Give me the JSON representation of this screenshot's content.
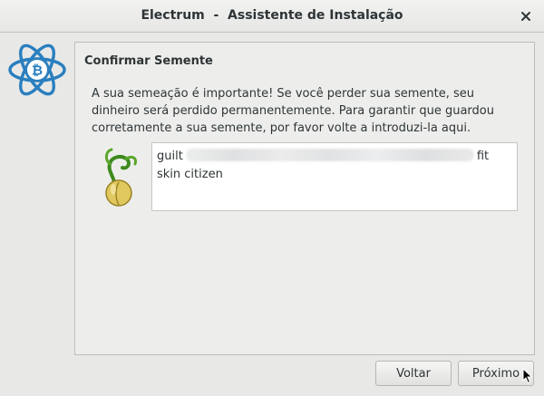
{
  "window": {
    "title": "Electrum  -  Assistente de Instalação",
    "close_icon": "close-icon"
  },
  "logo": {
    "icon": "electrum-bitcoin-atom-logo",
    "color": "#2a7fbf"
  },
  "page": {
    "section_title": "Confirmar Semente",
    "message": "A sua semeação é importante! Se você perder sua semente, seu dinheiro será perdido permanentemente. Para garantir que guardou corretamente a sua semente, por favor volte a introduzi-la aqui.",
    "seed_icon": "seed-sprout-icon",
    "seed_input": {
      "first_word": "guilt",
      "blurred_segment": "redacted-words",
      "last_word_line1": "fit",
      "line2": "skin citizen"
    }
  },
  "buttons": {
    "back_label": "Voltar",
    "next_label": "Próximo"
  }
}
